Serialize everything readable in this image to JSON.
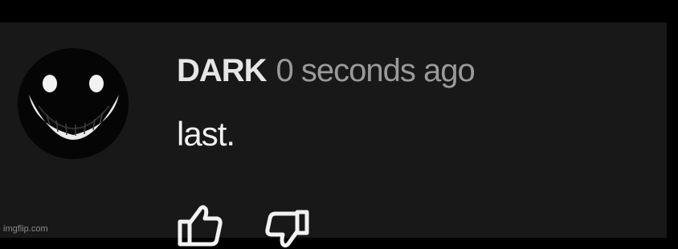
{
  "comment": {
    "author": "DARK",
    "timestamp": "0 seconds ago",
    "text": "last."
  },
  "actions": {
    "like_icon": "thumbs-up-icon",
    "dislike_icon": "thumbs-down-icon"
  },
  "watermark": {
    "text": "imgflip.com"
  },
  "colors": {
    "panel_background": "#181818",
    "frame_background": "#000000",
    "author_text": "#e6e6e6",
    "timestamp_text": "#9a9a9a",
    "comment_text": "#f0f0f0"
  }
}
